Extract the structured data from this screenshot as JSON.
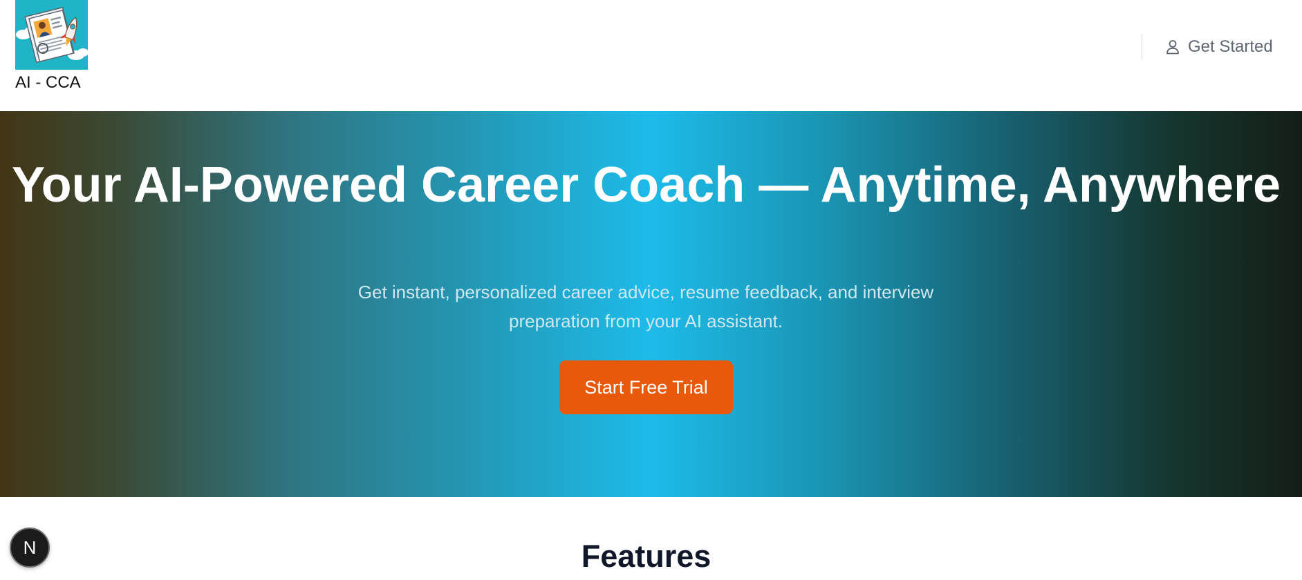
{
  "brand": {
    "name": "AI - CCA",
    "logo_icon": "resume-rocket-logo"
  },
  "nav": {
    "get_started_label": "Get Started",
    "get_started_icon": "user-icon"
  },
  "hero": {
    "title": "Your AI-Powered Career Coach — Anytime, Anywhere",
    "subtitle": "Get instant, personalized career advice, resume feedback, and interview preparation from your AI assistant.",
    "cta_label": "Start Free Trial"
  },
  "features": {
    "title": "Features"
  },
  "dev_badge": {
    "letter": "N",
    "icon": "nextjs-icon"
  },
  "colors": {
    "cta": "#e8590c",
    "hero_center": "#1dbbe9",
    "hero_left": "#433515",
    "hero_right": "#141e16",
    "logo_bg": "#1fb4c6"
  }
}
